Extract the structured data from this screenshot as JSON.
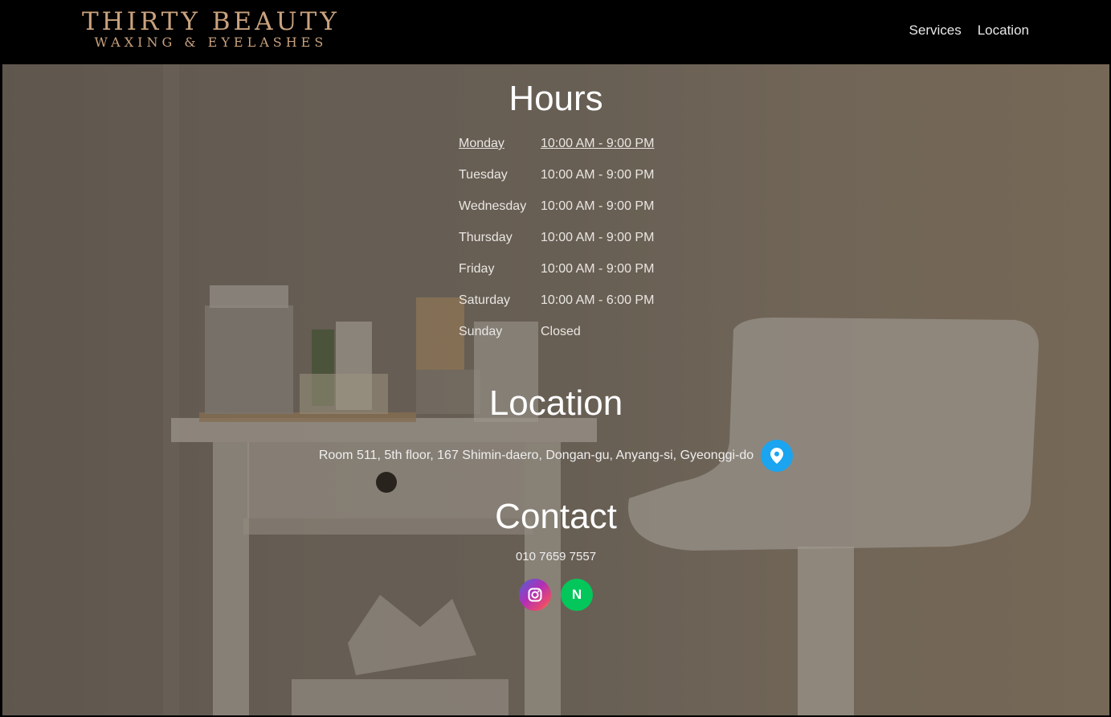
{
  "header": {
    "logo_main": "THIRTY BEAUTY",
    "logo_sub": "WAXING & EYELASHES",
    "nav": [
      {
        "label": "Services"
      },
      {
        "label": "Location"
      }
    ]
  },
  "hours": {
    "title": "Hours",
    "rows": [
      {
        "day": "Monday",
        "time": "10:00 AM - 9:00 PM"
      },
      {
        "day": "Tuesday",
        "time": "10:00 AM - 9:00 PM"
      },
      {
        "day": "Wednesday",
        "time": "10:00 AM - 9:00 PM"
      },
      {
        "day": "Thursday",
        "time": "10:00 AM - 9:00 PM"
      },
      {
        "day": "Friday",
        "time": "10:00 AM - 9:00 PM"
      },
      {
        "day": "Saturday",
        "time": "10:00 AM - 6:00 PM"
      },
      {
        "day": "Sunday",
        "time": "Closed"
      }
    ]
  },
  "location": {
    "title": "Location",
    "address": "Room 511, 5th floor, 167 Shimin-daero, Dongan-gu, Anyang-si, Gyeonggi-do",
    "map_icon": "map-pin-icon"
  },
  "contact": {
    "title": "Contact",
    "phone": "010 7659 7557",
    "social": [
      {
        "icon": "instagram-icon"
      },
      {
        "icon": "naver-icon",
        "glyph": "N"
      }
    ]
  },
  "colors": {
    "logo": "#c9a27e",
    "map_button": "#1ba4ef",
    "naver_button": "#03c75a"
  }
}
